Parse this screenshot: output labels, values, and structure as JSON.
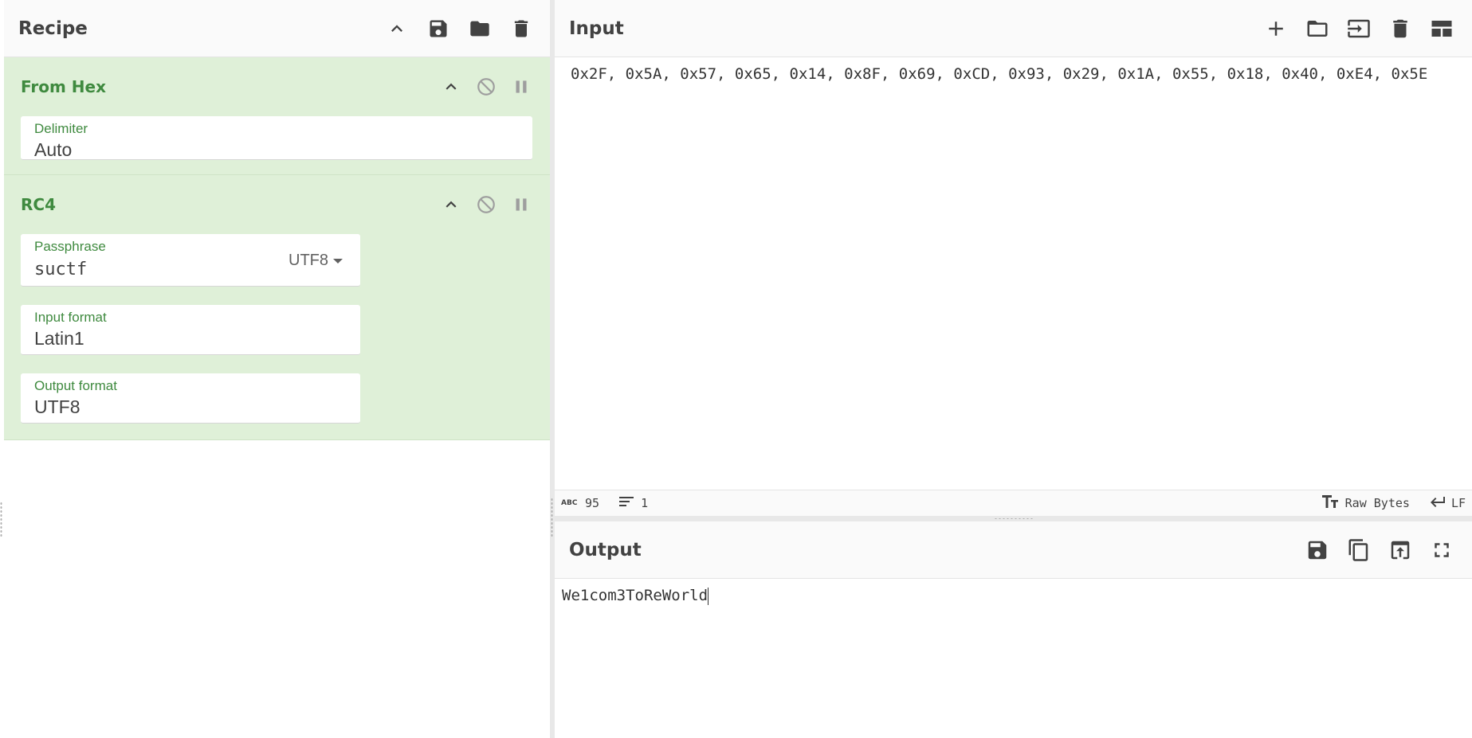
{
  "recipe": {
    "title": "Recipe",
    "operations": [
      {
        "name": "From Hex",
        "fields": [
          {
            "label": "Delimiter",
            "value": "Auto"
          }
        ]
      },
      {
        "name": "RC4",
        "fields": [
          {
            "label": "Passphrase",
            "value": "suctf",
            "encoding": "UTF8"
          },
          {
            "label": "Input format",
            "value": "Latin1"
          },
          {
            "label": "Output format",
            "value": "UTF8"
          }
        ]
      }
    ]
  },
  "input": {
    "title": "Input",
    "text": "0x2F, 0x5A, 0x57, 0x65, 0x14, 0x8F, 0x69, 0xCD, 0x93, 0x29, 0x1A, 0x55, 0x18, 0x40, 0xE4, 0x5E",
    "status": {
      "char_count": "95",
      "line_count": "1",
      "encoding": "Raw Bytes",
      "eol": "LF"
    }
  },
  "output": {
    "title": "Output",
    "text": "We1com3ToReWorld"
  }
}
